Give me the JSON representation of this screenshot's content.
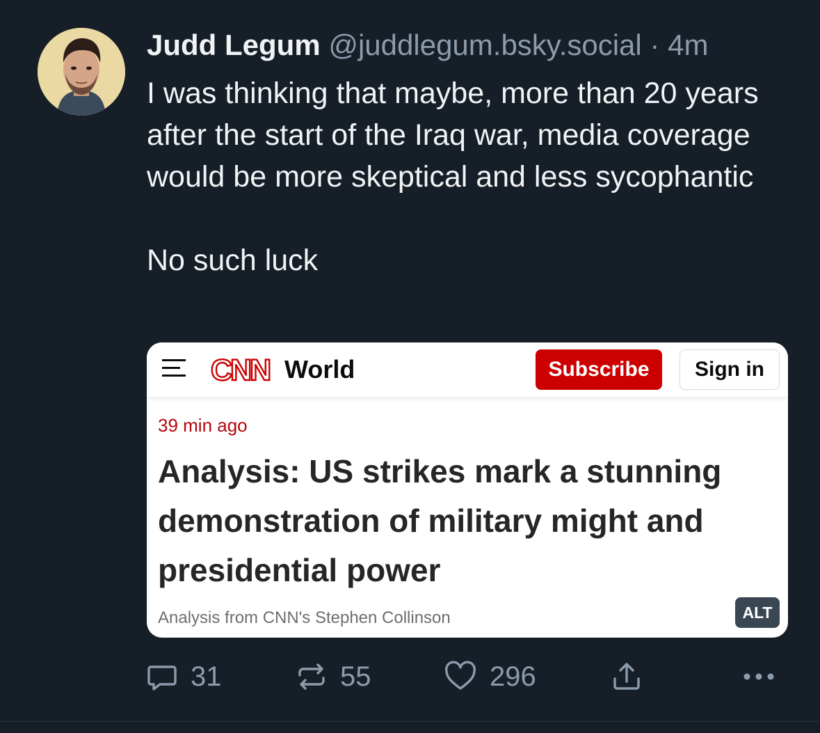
{
  "post": {
    "author_name": "Judd Legum",
    "author_handle": "@juddlegum.bsky.social",
    "separator": "·",
    "time_ago": "4m",
    "text_paragraph_1": "I was thinking that maybe, more than 20 years after the start of the Iraq war, media coverage would be more skeptical and less sycophantic",
    "text_paragraph_2": "No such luck"
  },
  "embedded_image": {
    "cnn_section": "World",
    "subscribe_label": "Subscribe",
    "signin_label": "Sign in",
    "timestamp": "39 min ago",
    "headline": "Analysis: US strikes mark a stunning demonstration of military might and presidential power",
    "byline": "Analysis from CNN's Stephen Collinson",
    "alt_badge": "ALT",
    "logo_text": "CNN",
    "brand_color": "#cc0000"
  },
  "actions": {
    "replies": "31",
    "reposts": "55",
    "likes": "296",
    "reply_icon": "reply-icon",
    "repost_icon": "repost-icon",
    "like_icon": "heart-icon",
    "share_icon": "share-icon",
    "more_icon": "more-icon"
  },
  "colors": {
    "background": "#161e27",
    "muted_text": "#8c9baa",
    "primary_text": "#f1f3f5"
  }
}
